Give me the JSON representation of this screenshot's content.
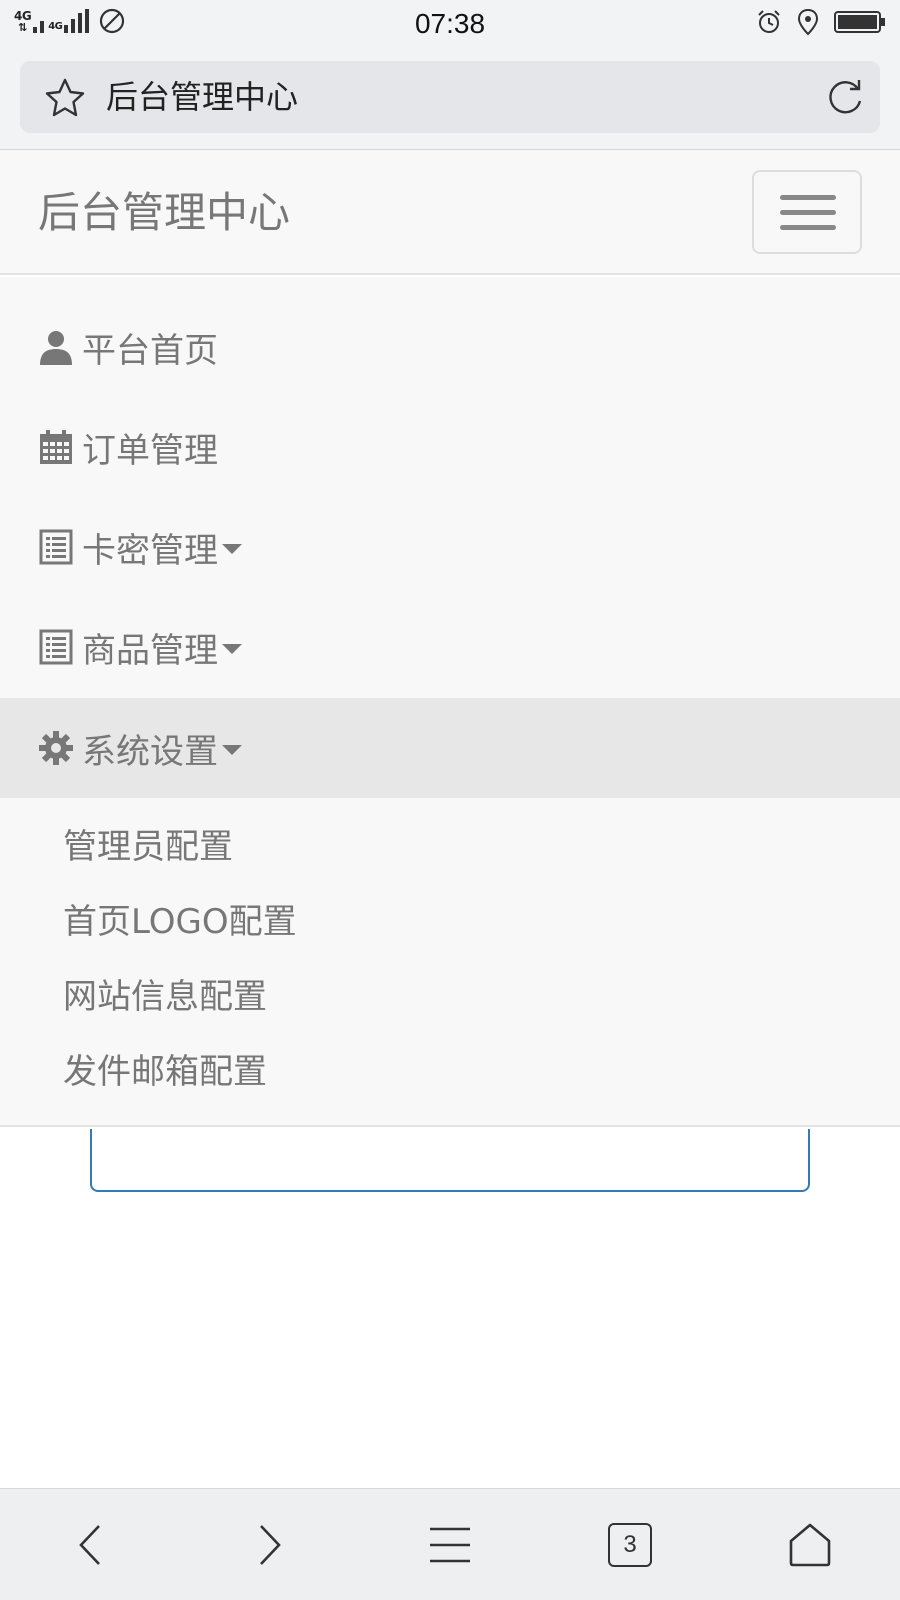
{
  "status_bar": {
    "network_1": "4G",
    "network_2": "4G",
    "time": "07:38"
  },
  "address_bar": {
    "title": "后台管理中心"
  },
  "navbar": {
    "brand": "后台管理中心"
  },
  "menu": {
    "items": [
      {
        "label": "平台首页",
        "icon": "user-icon"
      },
      {
        "label": "订单管理",
        "icon": "calendar-icon"
      },
      {
        "label": "卡密管理",
        "icon": "list-icon"
      },
      {
        "label": "商品管理",
        "icon": "list-icon"
      },
      {
        "label": "系统设置",
        "icon": "gear-icon"
      }
    ],
    "submenu": [
      {
        "label": "管理员配置"
      },
      {
        "label": "首页LOGO配置"
      },
      {
        "label": "网站信息配置"
      },
      {
        "label": "发件邮箱配置"
      }
    ]
  },
  "bottom_bar": {
    "tab_count": "3"
  },
  "colors": {
    "navbar_bg": "#f8f8f8",
    "active_item_bg": "#e7e7e7",
    "text": "#777777",
    "input_border": "#337ab7"
  }
}
